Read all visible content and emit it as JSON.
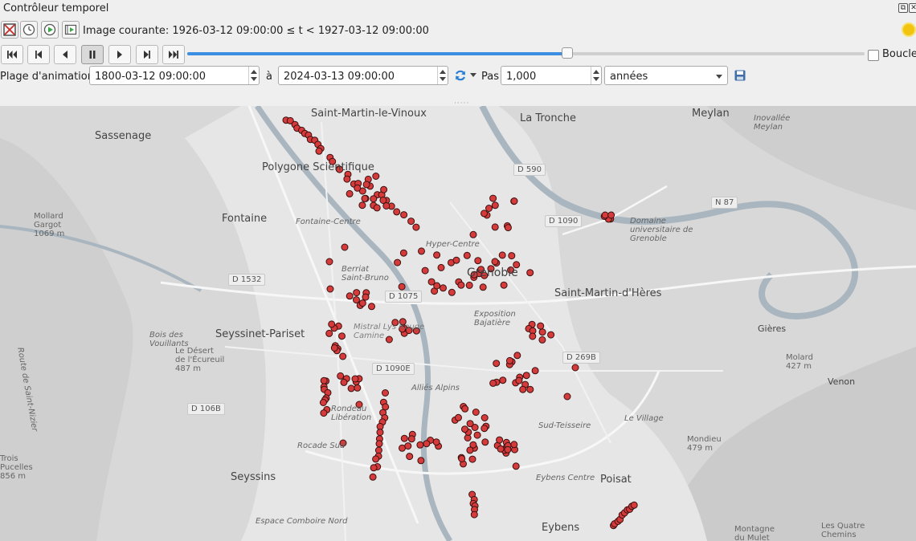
{
  "window": {
    "title": "Contrôleur temporel",
    "restore_label": "⧉",
    "close_label": "✕"
  },
  "navigation_mode": {
    "current_image_text": "Image courante: 1926-03-12 09:00:00 ≤ t < 1927-03-12 09:00:00"
  },
  "playback": {
    "progress": 0.56,
    "loop_label": "Boucle",
    "loop_checked": false
  },
  "range": {
    "label": "Plage d'animation",
    "start": "1800-03-12 09:00:00",
    "to_label": "à",
    "end": "2024-03-13 09:00:00",
    "step_label": "Pas",
    "step_value": "1,000",
    "unit": "années"
  },
  "map": {
    "labels": [
      "Saint-Martin-le-Vinoux",
      "La Tronche",
      "Meylan",
      "Sassenage",
      "Polygone Scientifique",
      "Fontaine",
      "Fontaine-Centre",
      "Grenoble",
      "Saint-Martin-d'Hères",
      "Seyssinet-Pariset",
      "Gières",
      "Seyssins",
      "Eybens",
      "Poisat",
      "Venon",
      "Le Village",
      "Mondieu 479 m",
      "Molard 427 m",
      "Domaine universitaire de Grenoble",
      "Inovallée Meylan",
      "Mollard Gargot 1069 m",
      "Le Désert de l'Écureuil 487 m",
      "Bois des Vouillants",
      "Trois Pucelles 856 m",
      "Hyper-Centre",
      "Berriat Saint-Bruno",
      "Exposition Bajatière",
      "Alliés Alpins",
      "Mistral Lys Rouge Camine",
      "Rondeau Libération",
      "Sud-Teisseire",
      "Eybens Centre",
      "Espace Comboire Nord",
      "Montagne du Mulet",
      "Les Quatre Chemins",
      "Rocade Sud",
      "Route de Saint-Nizier"
    ],
    "road_labels": [
      "D 590",
      "D 1090",
      "N 87",
      "D 1532",
      "D 1075",
      "D 269B",
      "D 106B",
      "D 1090E"
    ],
    "point_color": "#d63b3b"
  }
}
